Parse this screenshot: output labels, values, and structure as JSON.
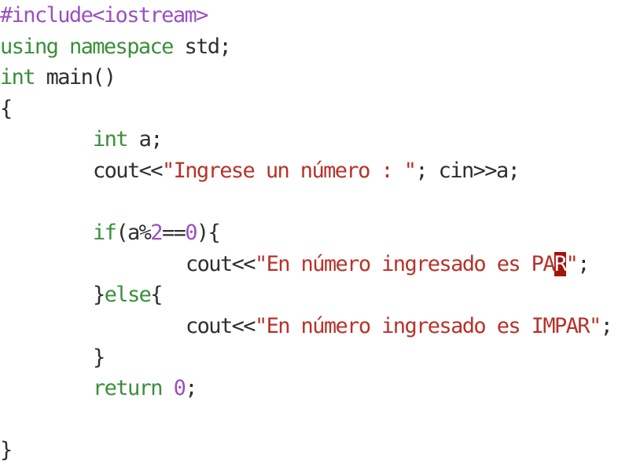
{
  "editor": {
    "lines": [
      {
        "tokens": [
          {
            "t": "#include<iostream>",
            "k": "preproc"
          }
        ]
      },
      {
        "tokens": [
          {
            "t": "using",
            "k": "keyword"
          },
          {
            "t": " ",
            "k": "text"
          },
          {
            "t": "namespace",
            "k": "keyword"
          },
          {
            "t": " std;",
            "k": "text"
          }
        ]
      },
      {
        "tokens": [
          {
            "t": "int",
            "k": "type"
          },
          {
            "t": " main()",
            "k": "text"
          }
        ]
      },
      {
        "tokens": [
          {
            "t": "{",
            "k": "text"
          }
        ]
      },
      {
        "tokens": [
          {
            "t": "int",
            "k": "type"
          },
          {
            "t": " a;",
            "k": "text"
          }
        ]
      },
      {
        "tokens": [
          {
            "t": "cout<<",
            "k": "text"
          },
          {
            "t": "\"Ingrese un número : \"",
            "k": "string"
          },
          {
            "t": "; cin>>a;",
            "k": "text"
          }
        ]
      },
      {
        "tokens": []
      },
      {
        "tokens": [
          {
            "t": "if",
            "k": "keyword"
          },
          {
            "t": "(a%",
            "k": "text"
          },
          {
            "t": "2",
            "k": "number"
          },
          {
            "t": "==",
            "k": "text"
          },
          {
            "t": "0",
            "k": "number"
          },
          {
            "t": "){",
            "k": "text"
          }
        ]
      },
      {
        "tokens": [
          {
            "t": "cout<<",
            "k": "text"
          },
          {
            "t": "\"En número ingresado es PA",
            "k": "string"
          },
          {
            "t": "R",
            "k": "cursor"
          },
          {
            "t": "\"",
            "k": "string"
          },
          {
            "t": ";",
            "k": "text"
          }
        ]
      },
      {
        "tokens": [
          {
            "t": "}",
            "k": "text"
          },
          {
            "t": "else",
            "k": "keyword"
          },
          {
            "t": "{",
            "k": "text"
          }
        ]
      },
      {
        "tokens": [
          {
            "t": "cout<<",
            "k": "text"
          },
          {
            "t": "\"En número ingresado es IMPAR\"",
            "k": "string"
          },
          {
            "t": ";",
            "k": "text"
          }
        ]
      },
      {
        "tokens": [
          {
            "t": "}",
            "k": "text"
          }
        ]
      },
      {
        "tokens": [
          {
            "t": "return",
            "k": "keyword"
          },
          {
            "t": " ",
            "k": "text"
          },
          {
            "t": "0",
            "k": "number"
          },
          {
            "t": ";",
            "k": "text"
          }
        ]
      },
      {
        "tokens": []
      },
      {
        "tokens": [
          {
            "t": "}",
            "k": "text"
          }
        ]
      }
    ]
  },
  "colors": {
    "preprocessor": "#9c4fc4",
    "keyword": "#3a8f3a",
    "string": "#b8322a",
    "number": "#9c4fc4",
    "text": "#2f2f2f",
    "cursor_bg": "#a1160e",
    "background": "#ffffff"
  }
}
